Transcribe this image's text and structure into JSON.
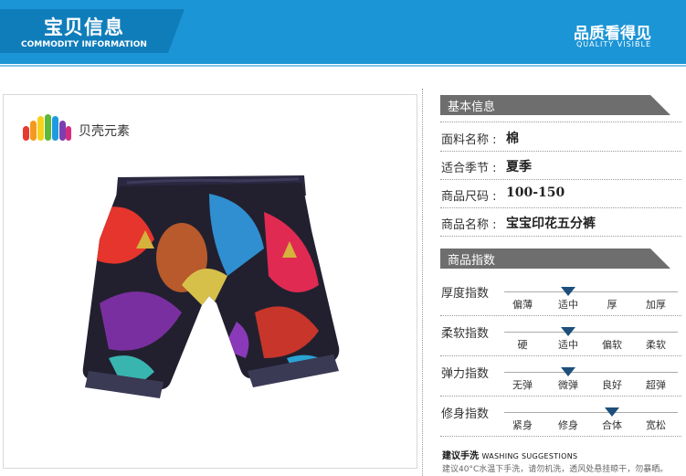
{
  "header": {
    "tab_title": "宝贝信息",
    "tab_subtitle": "COMMODITY INFORMATION",
    "right_title": "品质看得见",
    "right_subtitle": "QUALITY VISIBLE"
  },
  "brand": {
    "name": "贝壳元素"
  },
  "basic_info": {
    "title": "基本信息",
    "rows": [
      {
        "label": "面料名称 :",
        "value": "棉"
      },
      {
        "label": "适合季节 :",
        "value": "夏季"
      },
      {
        "label": "商品尺码 :",
        "value": "100-150"
      },
      {
        "label": "商品名称 :",
        "value": "宝宝印花五分裤"
      }
    ]
  },
  "indices": {
    "title": "商品指数",
    "rows": [
      {
        "label": "厚度指数",
        "options": [
          "偏薄",
          "适中",
          "厚",
          "加厚"
        ],
        "selected": 1
      },
      {
        "label": "柔软指数",
        "options": [
          "硬",
          "适中",
          "偏软",
          "柔软"
        ],
        "selected": 1
      },
      {
        "label": "弹力指数",
        "options": [
          "无弹",
          "微弹",
          "良好",
          "超弹"
        ],
        "selected": 1
      },
      {
        "label": "修身指数",
        "options": [
          "紧身",
          "修身",
          "合体",
          "宽松"
        ],
        "selected": 2
      }
    ]
  },
  "washing": {
    "title": "建议手洗",
    "title_en": "WASHING SUGGESTIONS",
    "text": "建议40°C水温下手洗，请勿机洗，透风处悬挂晾干，勿暴晒。"
  },
  "colors": {
    "banner": "#1c95d6",
    "tab": "#107dbb",
    "section_header": "#6e6e6e",
    "marker": "#1d4f7a"
  }
}
